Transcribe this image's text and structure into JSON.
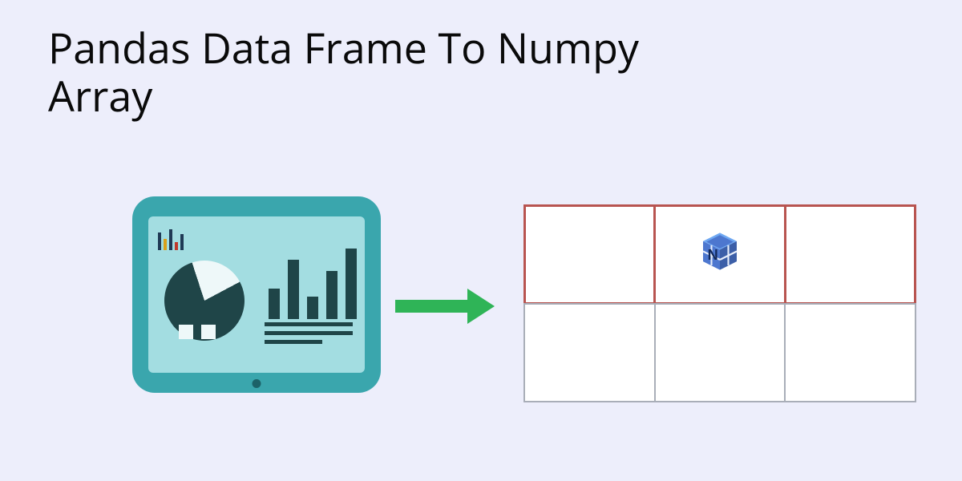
{
  "title": "Pandas Data Frame To Numpy Array",
  "left_illustration": "dashboard-tablet",
  "right_illustration": "numpy-grid",
  "colors": {
    "background": "#edeefb",
    "tablet_frame": "#3aa6ad",
    "tablet_screen": "#a3dde1",
    "chart_dark": "#1f4548",
    "arrow": "#2fb457",
    "grid_highlight": "#b85450",
    "grid_border": "#a9aeb8",
    "cell_fill": "#ffffff",
    "numpy_blue": "#4d77cf"
  },
  "grid": {
    "rows": 2,
    "cols": 3,
    "highlighted_row_index": 0,
    "numpy_logo_cell": {
      "row": 0,
      "col": 1
    }
  }
}
